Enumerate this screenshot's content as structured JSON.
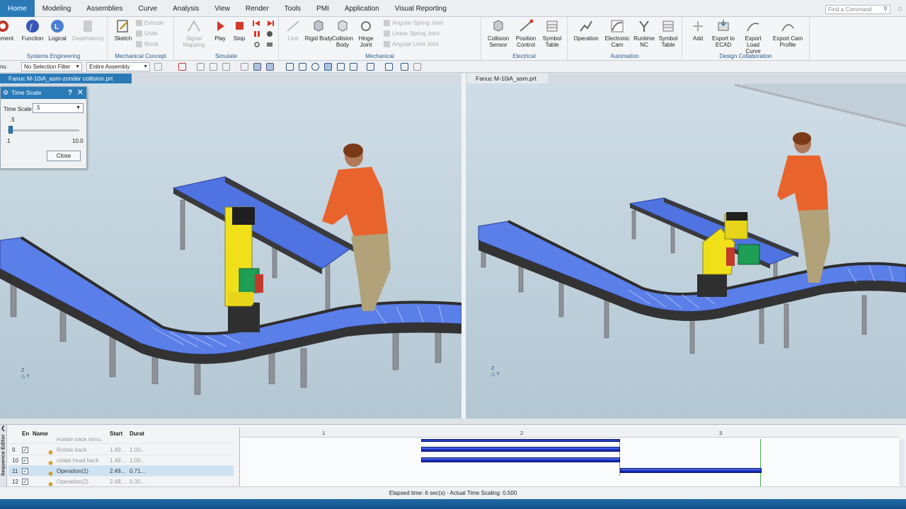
{
  "menu": {
    "tabs": [
      "Home",
      "Modeling",
      "Assemblies",
      "Curve",
      "Analysis",
      "View",
      "Render",
      "Tools",
      "PMI",
      "Application",
      "Visual Reporting"
    ],
    "active": "Home",
    "find_placeholder": "Find a Command"
  },
  "ribbon": {
    "systems_engineering": {
      "label": "Systems Engineering",
      "requirement": "ement",
      "function": "Function",
      "logical": "Logical",
      "dependency": "Dependency"
    },
    "mechanical_concept": {
      "label": "Mechanical Concept",
      "sketch": "Sketch",
      "extrude": "Extrude",
      "unite": "Unite",
      "block": "Block"
    },
    "simulate": {
      "label": "Simulate",
      "signal_mapping": "Signal Mapping",
      "play": "Play",
      "stop": "Stop"
    },
    "mechanical": {
      "label": "Mechanical",
      "line": "Line",
      "rigid_body": "Rigid Body",
      "collision_body": "Collision Body",
      "hinge_joint": "Hinge Joint",
      "angular_spring_joint": "Angular Spring Joint",
      "linear_spring_joint": "Linear Spring Joint",
      "angular_limit_joint": "Angular Limit Joint"
    },
    "electrical": {
      "label": "Electrical",
      "collision_sensor": "Collision Sensor",
      "position_control": "Position Control",
      "symbol_table": "Symbol Table"
    },
    "automation": {
      "label": "Automation",
      "operation": "Operation",
      "electronic_cam": "Electronic Cam",
      "runtime_nc": "Runtime NC",
      "symbol_table": "Symbol Table"
    },
    "design_collaboration": {
      "label": "Design Collaboration",
      "add": "Add",
      "export_ecad": "Export to ECAD",
      "export_load_curve": "Export Load Curve",
      "export_cam_profile": "Export Cam Profile"
    }
  },
  "toolbar": {
    "menu_stub": "nu",
    "selection_filter": "No Selection Filter",
    "assembly_scope": "Entire Assembly"
  },
  "documents": {
    "left_tab": "Fanuc M-10iA_asm-zonder collision.prt",
    "right_tab": "Fanuc M-10iA_asm.prt"
  },
  "dialog": {
    "title": "Time Scale",
    "help": "?",
    "close_x": "✕",
    "field_label": "Time Scale",
    "field_value": ".5",
    "slider_value": ".5",
    "slider_value_num": 0.5,
    "slider_min": ".1",
    "slider_max": "10.0",
    "close_button": "Close"
  },
  "sequence": {
    "side_label": "Sequence Editor",
    "headers": {
      "enabled": "En",
      "name": "Name",
      "start": "Start",
      "duration": "Durat"
    },
    "rows": [
      {
        "num": "9",
        "name": "Rotate back",
        "start": "1.49...",
        "duration": "1.00...",
        "selected": false
      },
      {
        "num": "10",
        "name": "rotate head back",
        "start": "1.49...",
        "duration": "1.00...",
        "selected": false
      },
      {
        "num": "11",
        "name": "Operation(1)",
        "start": "2.49...",
        "duration": "0.71...",
        "selected": true
      },
      {
        "num": "12",
        "name": "Operation(2)",
        "start": "2.48...",
        "duration": "0.30...",
        "selected": false
      }
    ],
    "partial_row_name": "Rotate back arm1",
    "ticks": [
      "1",
      "2",
      "3"
    ],
    "status": "Elapsed time: 6 sec(s) - Actual Time Scaling: 0.500"
  }
}
